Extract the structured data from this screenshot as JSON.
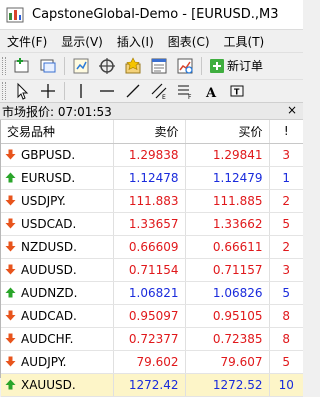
{
  "window": {
    "title": "CapstoneGlobal-Demo - [EURUSD.,M3"
  },
  "menu": [
    "文件(F)",
    "显示(V)",
    "插入(I)",
    "图表(C)",
    "工具(T)"
  ],
  "toolbar": {
    "new_order_label": "新订单"
  },
  "panel": {
    "title": "市场报价: 07:01:53",
    "close_label": "×"
  },
  "table": {
    "headers": {
      "symbol": "交易品种",
      "bid": "卖价",
      "ask": "买价",
      "spread": "!"
    },
    "rows": [
      {
        "symbol": "GBPUSD.",
        "bid": "1.29838",
        "ask": "1.29841",
        "spread": "3",
        "direction": "down",
        "color": "red"
      },
      {
        "symbol": "EURUSD.",
        "bid": "1.12478",
        "ask": "1.12479",
        "spread": "1",
        "direction": "up",
        "color": "blue"
      },
      {
        "symbol": "USDJPY.",
        "bid": "111.883",
        "ask": "111.885",
        "spread": "2",
        "direction": "down",
        "color": "red"
      },
      {
        "symbol": "USDCAD.",
        "bid": "1.33657",
        "ask": "1.33662",
        "spread": "5",
        "direction": "down",
        "color": "red"
      },
      {
        "symbol": "NZDUSD.",
        "bid": "0.66609",
        "ask": "0.66611",
        "spread": "2",
        "direction": "down",
        "color": "red"
      },
      {
        "symbol": "AUDUSD.",
        "bid": "0.71154",
        "ask": "0.71157",
        "spread": "3",
        "direction": "down",
        "color": "red"
      },
      {
        "symbol": "AUDNZD.",
        "bid": "1.06821",
        "ask": "1.06826",
        "spread": "5",
        "direction": "up",
        "color": "blue"
      },
      {
        "symbol": "AUDCAD.",
        "bid": "0.95097",
        "ask": "0.95105",
        "spread": "8",
        "direction": "down",
        "color": "red"
      },
      {
        "symbol": "AUDCHF.",
        "bid": "0.72377",
        "ask": "0.72385",
        "spread": "8",
        "direction": "down",
        "color": "red"
      },
      {
        "symbol": "AUDJPY.",
        "bid": "79.602",
        "ask": "79.607",
        "spread": "5",
        "direction": "down",
        "color": "red"
      },
      {
        "symbol": "XAUUSD.",
        "bid": "1272.42",
        "ask": "1272.52",
        "spread": "10",
        "direction": "up",
        "color": "blue",
        "selected": true
      }
    ]
  },
  "colors": {
    "down": "#e0181b",
    "up": "#1a2bdc",
    "up_arrow": "#2aa52a",
    "down_arrow": "#e8541c",
    "selected_row": "#fdf5c8"
  },
  "icons": [
    "app-logo-icon",
    "new-chart-icon",
    "profiles-icon",
    "market-watch-icon",
    "navigator-icon",
    "favorites-icon",
    "terminal-icon",
    "strategy-tester-icon",
    "new-order-icon",
    "cursor-icon",
    "crosshair-icon",
    "vertical-line-icon",
    "horizontal-line-icon",
    "trendline-icon",
    "equidistant-channel-icon",
    "fibonacci-icon",
    "text-icon",
    "label-icon"
  ]
}
